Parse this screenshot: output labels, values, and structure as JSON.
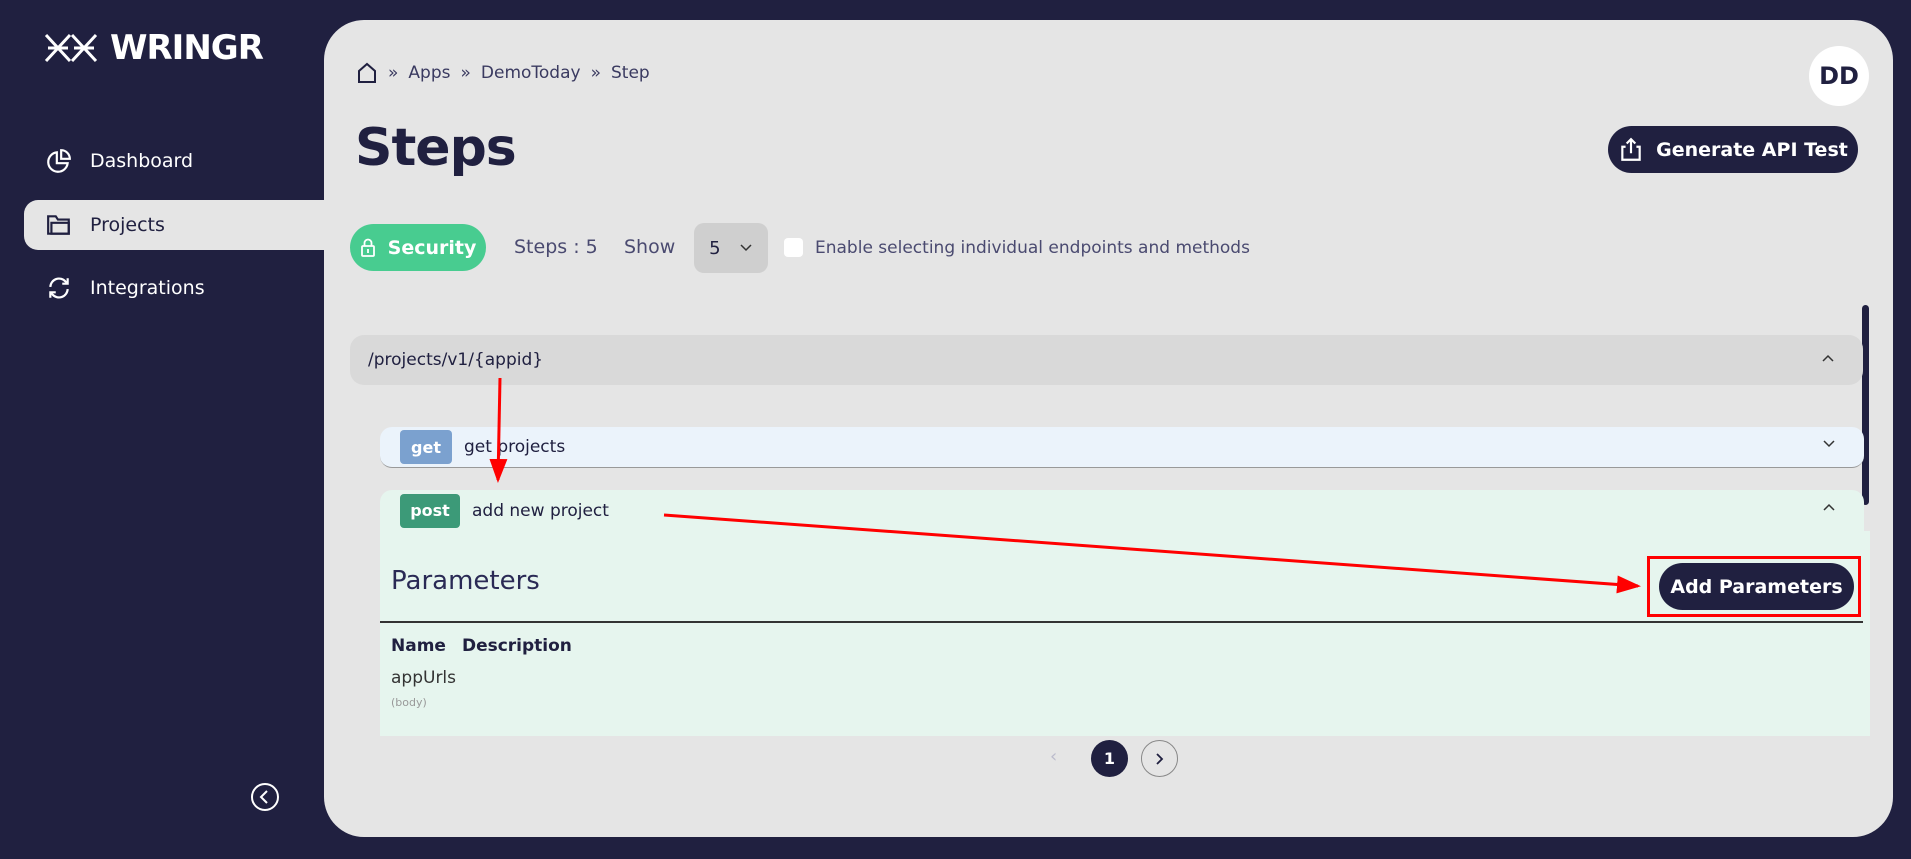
{
  "brand": {
    "name": "WRINGR"
  },
  "sidebar": {
    "items": [
      {
        "label": "Dashboard",
        "icon": "pie-chart-icon"
      },
      {
        "label": "Projects",
        "icon": "folder-icon",
        "active": true
      },
      {
        "label": "Integrations",
        "icon": "refresh-icon"
      }
    ],
    "collapse_icon": "chevron-left-circle-icon"
  },
  "breadcrumb": [
    "Apps",
    "DemoToday",
    "Step"
  ],
  "user": {
    "initials": "DD"
  },
  "page": {
    "title": "Steps",
    "generate_label": "Generate API Test"
  },
  "toolbar": {
    "security_label": "Security",
    "steps_label": "Steps : 5",
    "show_label": "Show",
    "show_value": "5",
    "checkbox_label": "Enable selecting individual endpoints and methods",
    "checkbox_checked": false
  },
  "endpoint": {
    "path": "/projects/v1/{appid}",
    "methods": [
      {
        "method": "get",
        "summary": "get projects",
        "color": "#7ba1cf",
        "expanded": false
      },
      {
        "method": "post",
        "summary": "add new project",
        "color": "#3c9a78",
        "expanded": true
      }
    ]
  },
  "parameters": {
    "title": "Parameters",
    "add_label": "Add Parameters",
    "col_name": "Name",
    "col_description": "Description",
    "items": [
      {
        "name": "appUrls",
        "in": "(body)"
      }
    ]
  },
  "pagination": {
    "current": "1"
  },
  "colors": {
    "sidebar": "#202040",
    "accent_green": "#48cc90",
    "annotation_red": "#ff0000"
  }
}
